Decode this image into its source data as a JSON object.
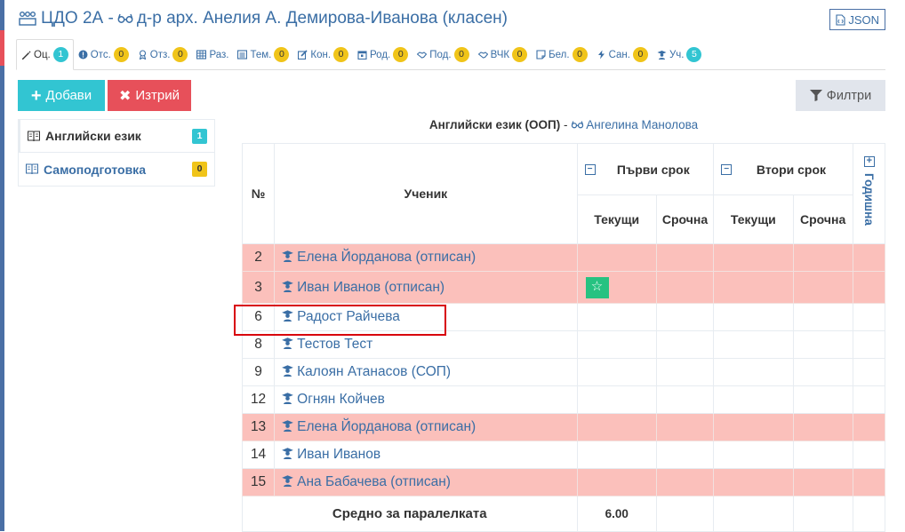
{
  "header": {
    "title_main": "ЦДО 2А - ",
    "title_teacher": "д-р арх. Анелия А. Демирова-Иванова (класен)",
    "json_label": "JSON"
  },
  "tabs": [
    {
      "label": "Оц.",
      "count": "1",
      "badge": "blue",
      "icon": "pencil-icon"
    },
    {
      "label": "Отс.",
      "count": "0",
      "badge": "yellow",
      "icon": "exclamation-icon"
    },
    {
      "label": "Отз.",
      "count": "0",
      "badge": "yellow",
      "icon": "award-icon"
    },
    {
      "label": "Раз.",
      "count": "",
      "badge": "",
      "icon": "grid-icon"
    },
    {
      "label": "Тем.",
      "count": "0",
      "badge": "yellow",
      "icon": "list-icon"
    },
    {
      "label": "Кон.",
      "count": "0",
      "badge": "yellow",
      "icon": "edit-icon"
    },
    {
      "label": "Род.",
      "count": "0",
      "badge": "yellow",
      "icon": "calendar-icon"
    },
    {
      "label": "Под.",
      "count": "0",
      "badge": "yellow",
      "icon": "handshake-icon"
    },
    {
      "label": "ВЧК",
      "count": "0",
      "badge": "yellow",
      "icon": "handshake-icon"
    },
    {
      "label": "Бел.",
      "count": "0",
      "badge": "yellow",
      "icon": "note-icon"
    },
    {
      "label": "Сан.",
      "count": "0",
      "badge": "yellow",
      "icon": "bolt-icon"
    },
    {
      "label": "Уч.",
      "count": "5",
      "badge": "blue",
      "icon": "student-icon"
    }
  ],
  "actions": {
    "add_label": "Добави",
    "delete_label": "Изтрий",
    "filter_label": "Филтри"
  },
  "subjects": [
    {
      "label": "Английски език",
      "count": "1",
      "badge": "blue",
      "active": true
    },
    {
      "label": "Самоподготовка",
      "count": "0",
      "badge": "yellow",
      "active": false
    }
  ],
  "subtitle": {
    "subject": "Английски език (ООП)",
    "separator": " - ",
    "teacher": "Ангелина Манолова"
  },
  "table": {
    "col_num": "№",
    "col_student": "Ученик",
    "term1": "Първи срок",
    "term2": "Втори срок",
    "annual": "Годишна",
    "current": "Текущи",
    "final": "Срочна",
    "rows": [
      {
        "num": "2",
        "name": "Елена Йорданова (отписан)",
        "pink": true
      },
      {
        "num": "3",
        "name": "Иван Иванов (отписан)",
        "pink": true,
        "star": true
      },
      {
        "num": "6",
        "name": "Радост Райчева",
        "pink": false
      },
      {
        "num": "8",
        "name": "Тестов Тест",
        "pink": false
      },
      {
        "num": "9",
        "name": "Калоян Атанасов (СОП)",
        "pink": false
      },
      {
        "num": "12",
        "name": "Огнян Койчев",
        "pink": false
      },
      {
        "num": "13",
        "name": "Елена Йорданова (отписан)",
        "pink": true
      },
      {
        "num": "14",
        "name": "Иван Иванов",
        "pink": false
      },
      {
        "num": "15",
        "name": "Ана Бабачева (отписан)",
        "pink": true
      }
    ],
    "avg_label": "Средно за паралелката",
    "avg_value": "6.00"
  },
  "colors": {
    "accent": "#3a6ea5",
    "add": "#32c5d2",
    "delete": "#e7505a",
    "pink_row": "#fbc0bb",
    "star": "#26c281",
    "highlight": "#d8000c"
  }
}
